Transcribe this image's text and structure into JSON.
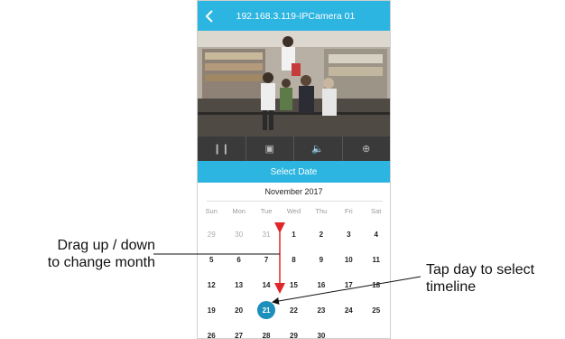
{
  "header": {
    "back_icon": "chevron-left-icon",
    "title": "192.168.3.119-IPCamera 01"
  },
  "video": {
    "description_icon": "camera-feed"
  },
  "controls": [
    {
      "name": "pause-button",
      "icon": "pause-icon",
      "glyph": "❙❙"
    },
    {
      "name": "record-button",
      "icon": "record-icon",
      "glyph": "▣"
    },
    {
      "name": "volume-button",
      "icon": "speaker-icon",
      "glyph": "🔈"
    },
    {
      "name": "zoom-button",
      "icon": "zoom-icon",
      "glyph": "⊕"
    }
  ],
  "date_bar": {
    "label": "Select Date"
  },
  "calendar": {
    "month_label": "November 2017",
    "weekdays": [
      "Sun",
      "Mon",
      "Tue",
      "Wed",
      "Thu",
      "Fri",
      "Sat"
    ],
    "weeks": [
      [
        {
          "d": "29",
          "muted": true
        },
        {
          "d": "30",
          "muted": true
        },
        {
          "d": "31",
          "muted": true
        },
        {
          "d": "1"
        },
        {
          "d": "2"
        },
        {
          "d": "3"
        },
        {
          "d": "4"
        }
      ],
      [
        {
          "d": "5"
        },
        {
          "d": "6"
        },
        {
          "d": "7"
        },
        {
          "d": "8"
        },
        {
          "d": "9"
        },
        {
          "d": "10"
        },
        {
          "d": "11"
        }
      ],
      [
        {
          "d": "12"
        },
        {
          "d": "13"
        },
        {
          "d": "14"
        },
        {
          "d": "15"
        },
        {
          "d": "16"
        },
        {
          "d": "17"
        },
        {
          "d": "18"
        }
      ],
      [
        {
          "d": "19"
        },
        {
          "d": "20"
        },
        {
          "d": "21",
          "selected": true
        },
        {
          "d": "22"
        },
        {
          "d": "23"
        },
        {
          "d": "24"
        },
        {
          "d": "25"
        }
      ],
      [
        {
          "d": "26"
        },
        {
          "d": "27"
        },
        {
          "d": "28"
        },
        {
          "d": "29"
        },
        {
          "d": "30"
        },
        {
          "d": ""
        },
        {
          "d": ""
        }
      ]
    ],
    "selected_day": "21"
  },
  "annotations": {
    "left_line1": "Drag up / down",
    "left_line2": "to change month",
    "right_line1": "Tap day to select",
    "right_line2": "timeline"
  },
  "colors": {
    "accent": "#2bb5e0",
    "selected": "#1d8fbc",
    "drag_arrow": "#e0262b"
  }
}
